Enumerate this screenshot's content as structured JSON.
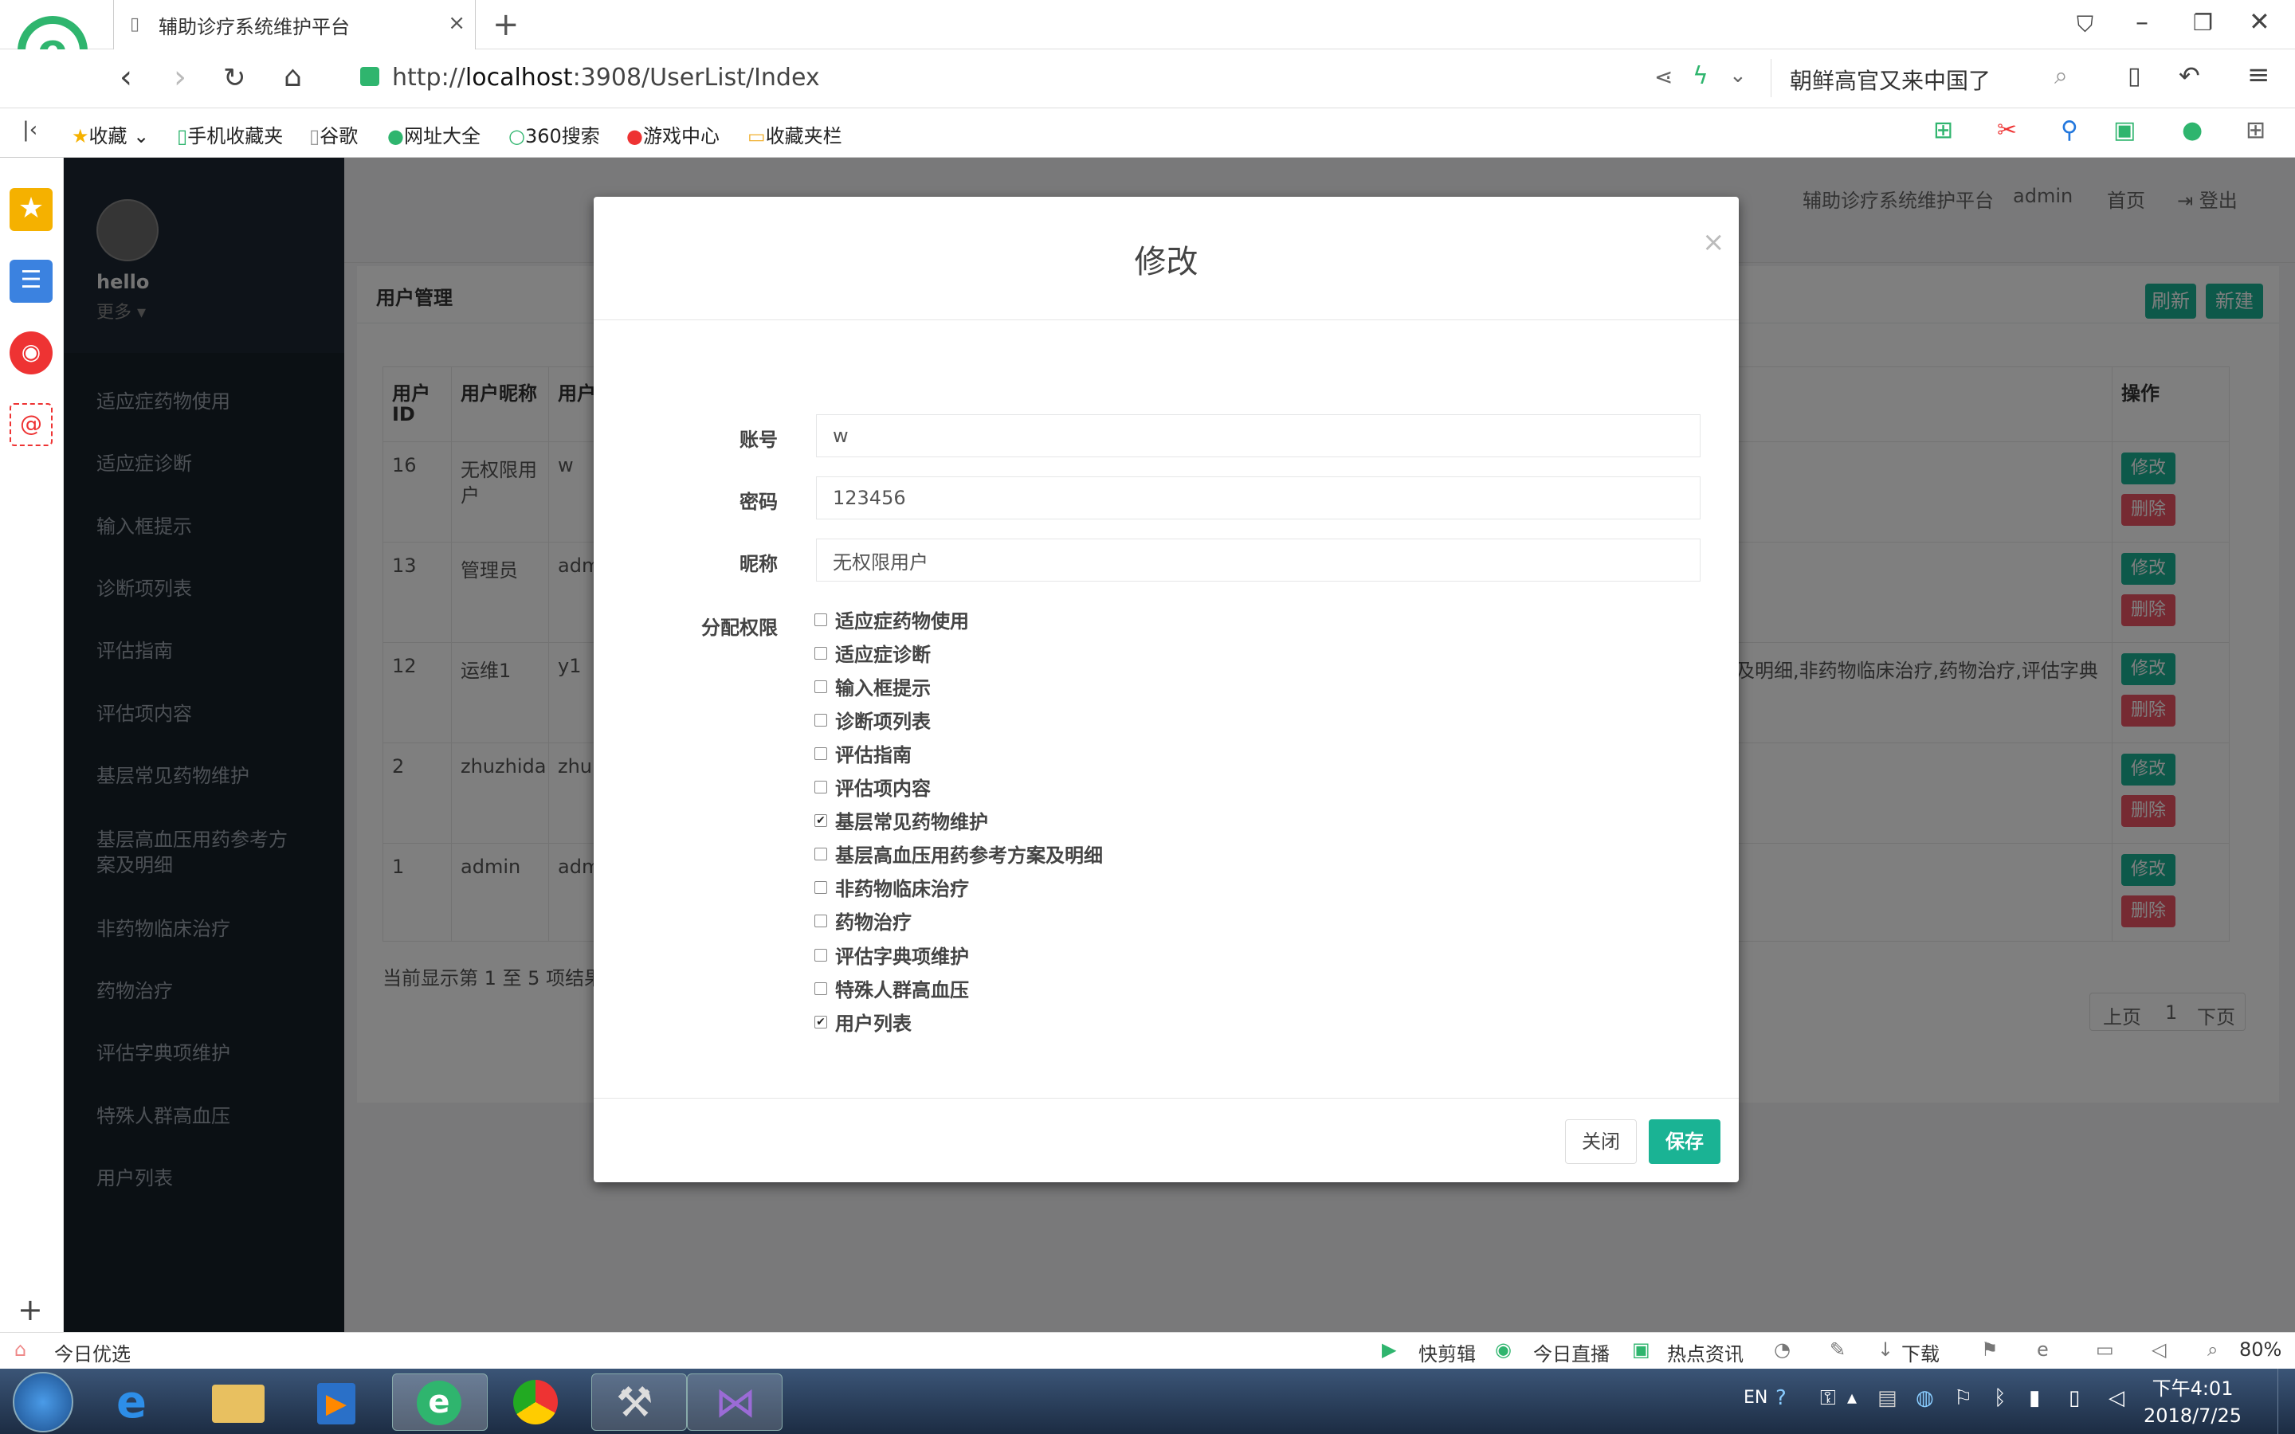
{
  "browser": {
    "tab_title": "辅助诊疗系统维护平台",
    "tab_close": "×",
    "new_tab": "+",
    "url_prefix": "http://",
    "url_host": "localhost",
    "url_rest": ":3908/UserList/Index",
    "search_text": "朝鲜高官又来中国了",
    "bookmarks": [
      "收藏",
      "手机收藏夹",
      "谷歌",
      "网址大全",
      "360搜索",
      "游戏中心",
      "收藏夹栏"
    ]
  },
  "sidebar": {
    "username": "hello",
    "more": "更多 ▾",
    "items": [
      "适应症药物使用",
      "适应症诊断",
      "输入框提示",
      "诊断项列表",
      "评估指南",
      "评估项内容",
      "基层常见药物维护",
      "基层高血压用药参考方",
      "案及明细",
      "非药物临床治疗",
      "药物治疗",
      "评估字典项维护",
      "特殊人群高血压",
      "用户列表"
    ]
  },
  "topnav": {
    "platform": "辅助诊疗系统维护平台",
    "user": "admin",
    "home": "首页",
    "logout": "登出"
  },
  "panel": {
    "title": "用户管理",
    "refresh": "刷新",
    "new": "新建",
    "columns": [
      "用户",
      "ID",
      "用户昵称",
      "用户",
      "操作"
    ],
    "rows": [
      {
        "id": "16",
        "nick": "无权限用",
        "nick2": "户",
        "acct": "w",
        "edit": "修改",
        "del": "删除"
      },
      {
        "id": "13",
        "nick": "管理员",
        "nick2": "",
        "acct": "adm",
        "edit": "修改",
        "del": "删除"
      },
      {
        "id": "12",
        "nick": "运维1",
        "nick2": "",
        "acct": "y1",
        "edit": "修改",
        "del": "删除"
      },
      {
        "id": "2",
        "nick": "zhuzhida",
        "nick2": "",
        "acct": "zhu",
        "edit": "修改",
        "del": "删除"
      },
      {
        "id": "1",
        "nick": "admin",
        "nick2": "",
        "acct": "adm",
        "edit": "修改",
        "del": "删除"
      }
    ],
    "row12_perms_tail": "及明细,非药物临床治疗,药物治疗,评估字典",
    "page_info": "当前显示第 1 至 5 项结果",
    "prev": "上页",
    "page": "1",
    "next": "下页"
  },
  "modal": {
    "title": "修改",
    "close_x": "×",
    "account_label": "账号",
    "account_value": "w",
    "password_label": "密码",
    "password_value": "123456",
    "nickname_label": "昵称",
    "nickname_value": "无权限用户",
    "perm_label": "分配权限",
    "permissions": [
      {
        "label": "适应症药物使用",
        "checked": false
      },
      {
        "label": "适应症诊断",
        "checked": false
      },
      {
        "label": "输入框提示",
        "checked": false
      },
      {
        "label": "诊断项列表",
        "checked": false
      },
      {
        "label": "评估指南",
        "checked": false
      },
      {
        "label": "评估项内容",
        "checked": false
      },
      {
        "label": "基层常见药物维护",
        "checked": true
      },
      {
        "label": "基层高血压用药参考方案及明细",
        "checked": false
      },
      {
        "label": "非药物临床治疗",
        "checked": false
      },
      {
        "label": "药物治疗",
        "checked": false
      },
      {
        "label": "评估字典项维护",
        "checked": false
      },
      {
        "label": "特殊人群高血压",
        "checked": false
      },
      {
        "label": "用户列表",
        "checked": true
      }
    ],
    "close_button": "关闭",
    "save_button": "保存"
  },
  "statusbar": {
    "left": "今日优选",
    "items": [
      "快剪辑",
      "今日直播",
      "热点资讯",
      "下载"
    ],
    "zoom": "80%"
  },
  "taskbar": {
    "lang": "EN",
    "time": "下午4:01",
    "date": "2018/7/25"
  },
  "colors": {
    "accent": "#1ab394",
    "danger": "#ed5565",
    "sidebar": "#172029"
  }
}
